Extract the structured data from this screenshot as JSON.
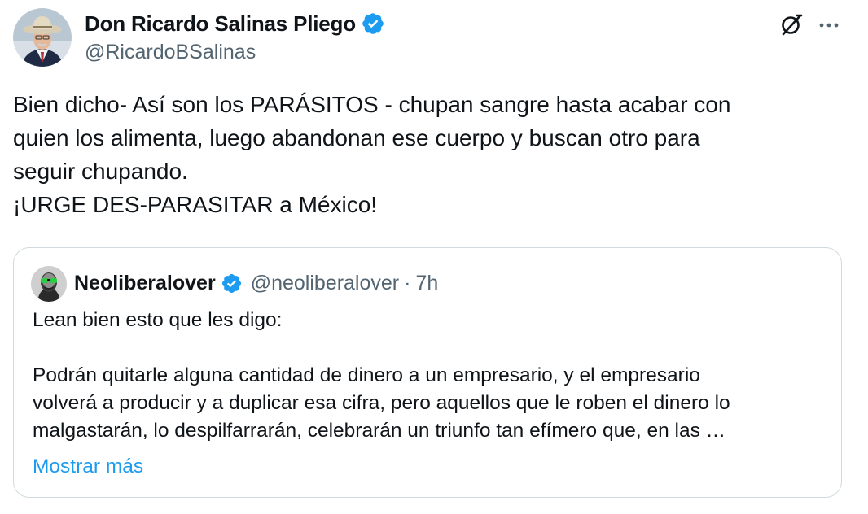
{
  "author": {
    "name": "Don Ricardo Salinas Pliego",
    "handle": "@RicardoBSalinas",
    "verified": true
  },
  "tweet": {
    "lines": [
      "Bien dicho- Así son los PARÁSITOS - chupan sangre hasta acabar con",
      "quien los alimenta, luego abandonan ese cuerpo y buscan otro para",
      "seguir chupando.",
      "¡URGE DES-PARASITAR a México!"
    ]
  },
  "quote": {
    "name": "Neoliberalover",
    "handle": "@neoliberalover",
    "separator": "·",
    "time": "7h",
    "verified": true,
    "lines": [
      "Lean bien esto que les digo:",
      "",
      "Podrán quitarle alguna cantidad de dinero a un empresario, y el empresario",
      "volverá a producir y a duplicar esa cifra, pero aquellos que le roben el dinero lo",
      "malgastarán, lo despilfarrarán, celebrarán un triunfo tan efímero que, en las …"
    ],
    "show_more": "Mostrar más"
  },
  "icons": {
    "grok": "grok-icon",
    "more": "more-icon",
    "verified": "verified-badge-icon"
  },
  "colors": {
    "link": "#1d9bf0",
    "verified": "#1d9bf0",
    "secondary_text": "#536471",
    "border": "#cfd9de"
  }
}
